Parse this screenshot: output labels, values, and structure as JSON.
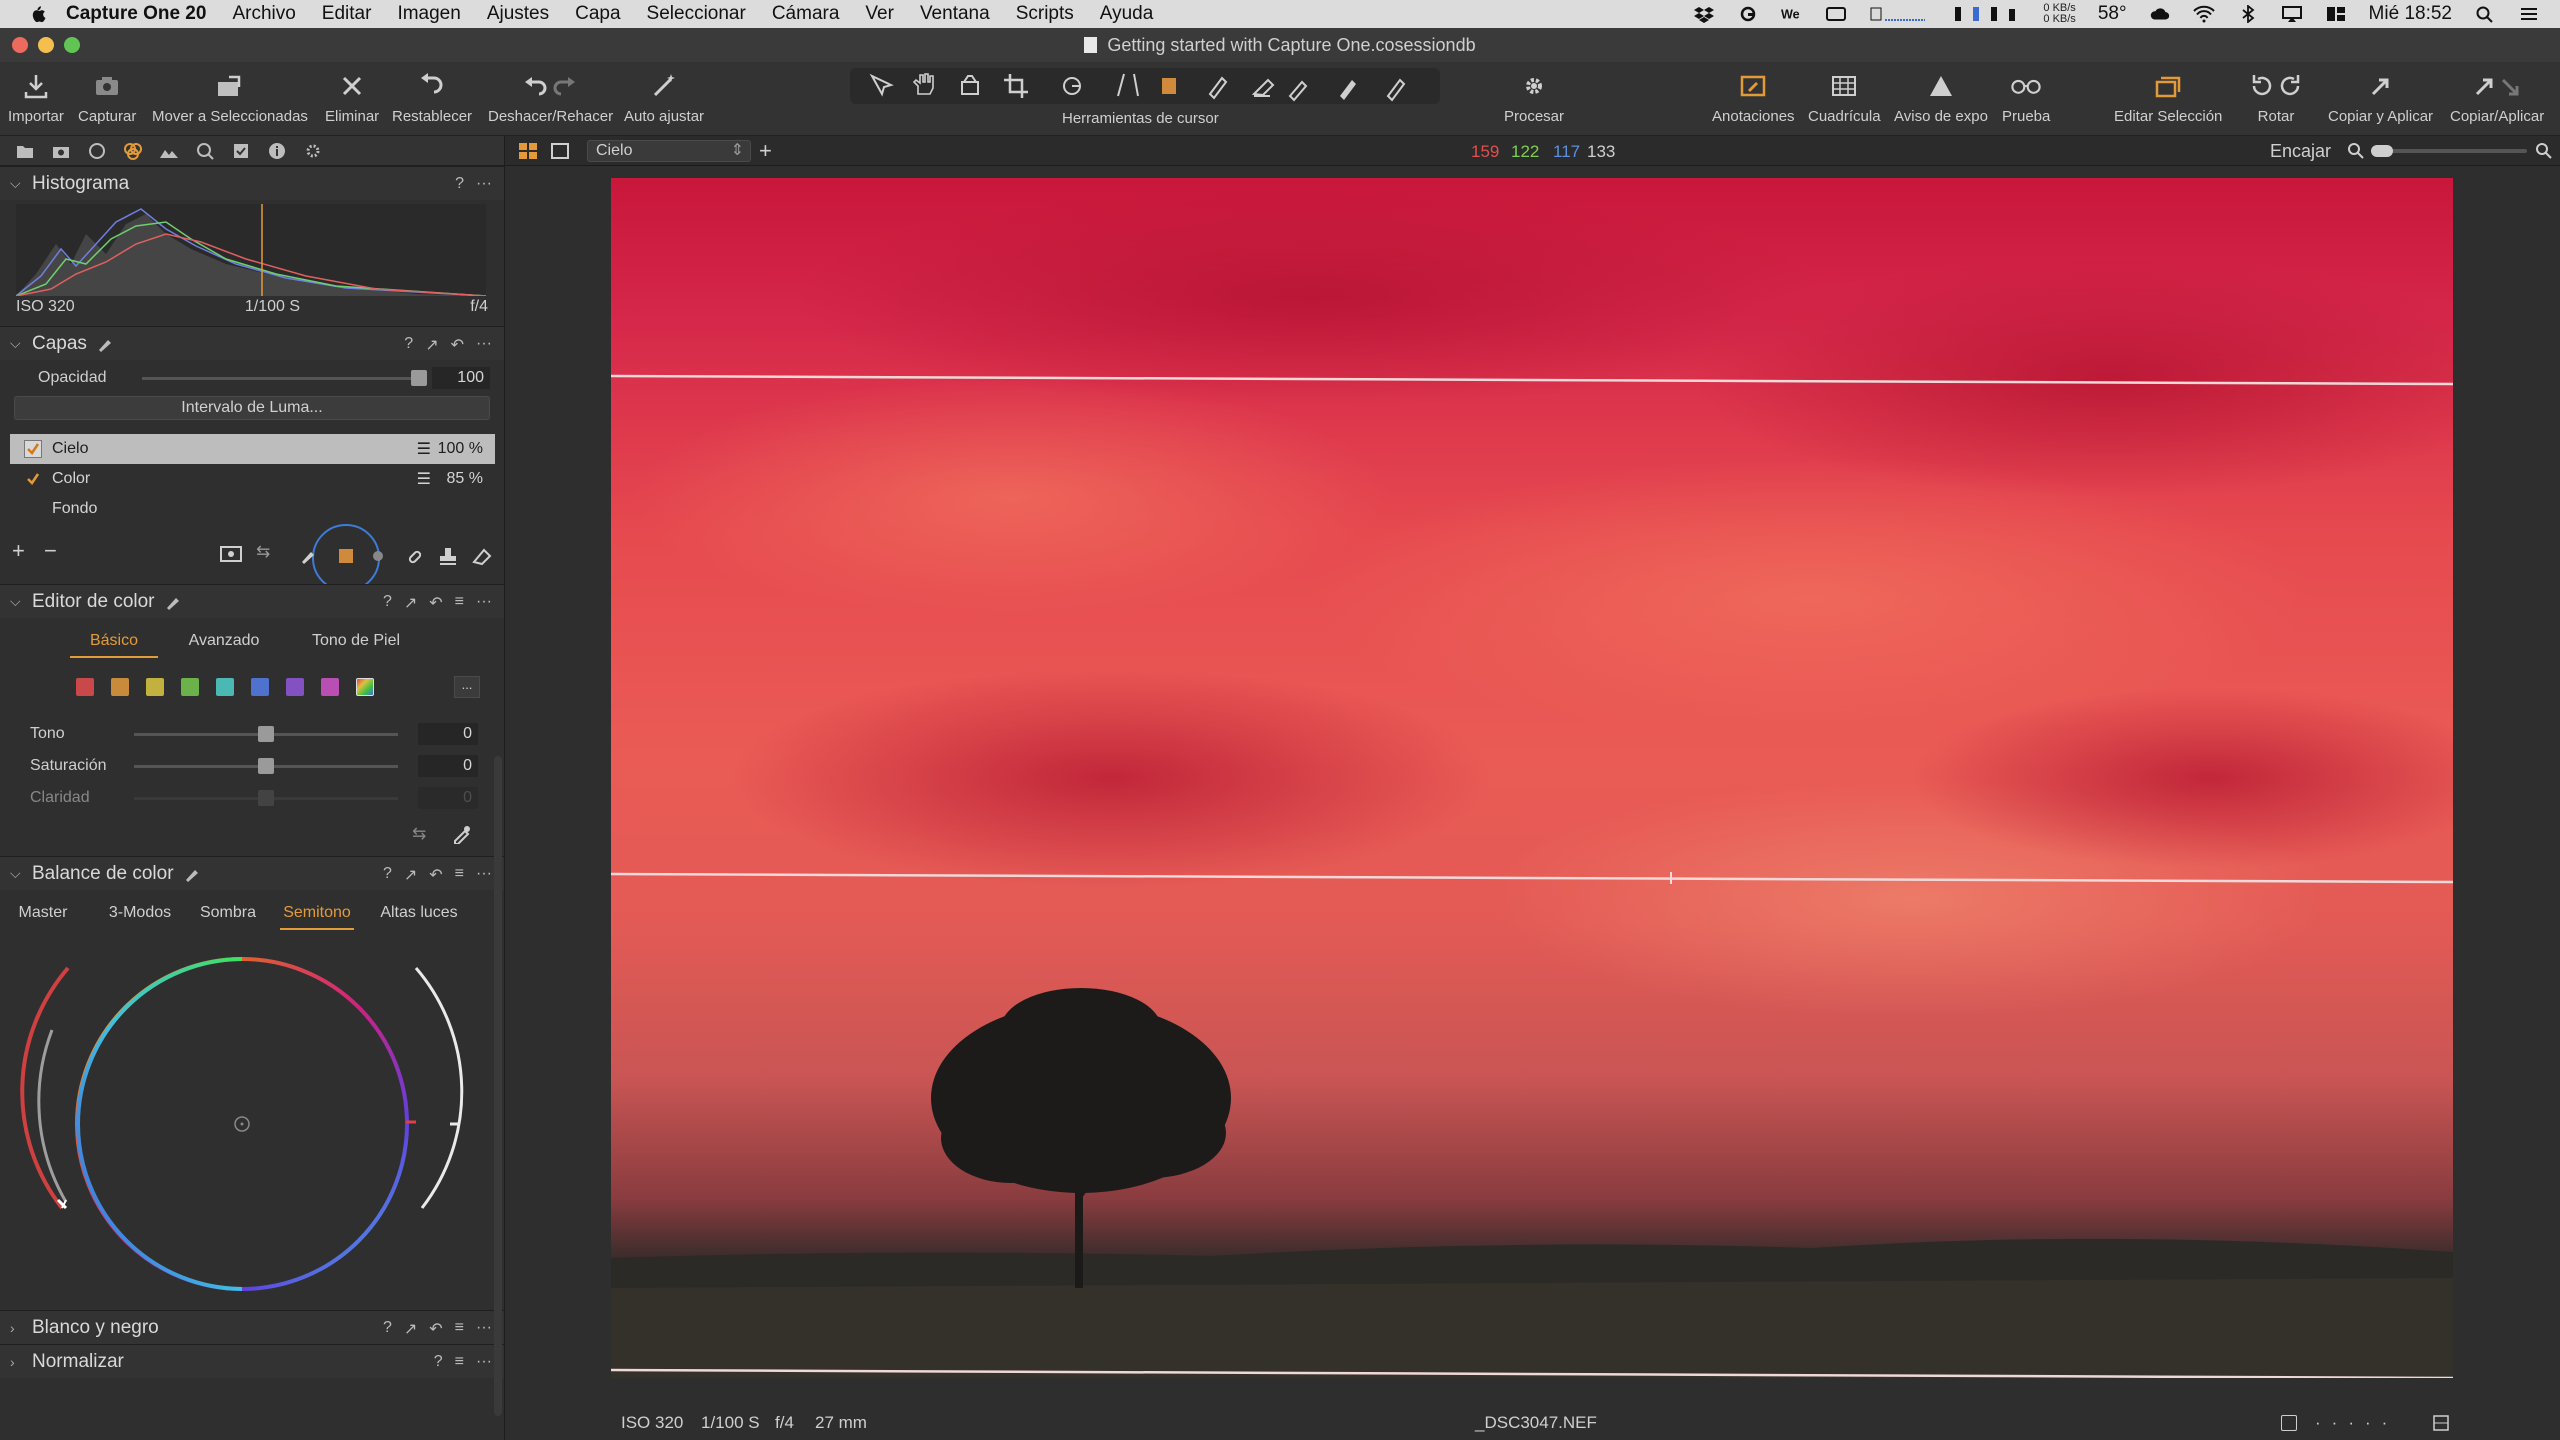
{
  "menubar": {
    "app_name": "Capture One 20",
    "items": [
      "Archivo",
      "Editar",
      "Imagen",
      "Ajustes",
      "Capa",
      "Seleccionar",
      "Cámara",
      "Ver",
      "Ventana",
      "Scripts",
      "Ayuda"
    ],
    "net_up": "0 KB/s",
    "net_down": "0 KB/s",
    "temperature": "58°",
    "clock": "Mié 18:52"
  },
  "window": {
    "title": "Getting started with Capture One.cosessiondb"
  },
  "toolbar": {
    "tools": [
      {
        "label": "Importar",
        "icon": "import-icon"
      },
      {
        "label": "Capturar",
        "icon": "camera-icon"
      },
      {
        "label": "Mover a Seleccionadas",
        "icon": "move-icon"
      },
      {
        "label": "Eliminar",
        "icon": "delete-icon"
      },
      {
        "label": "Restablecer",
        "icon": "reset-icon"
      },
      {
        "label": "Deshacer/Rehacer",
        "icon": "undo-icon"
      },
      {
        "label": "Auto ajustar",
        "icon": "wand-icon"
      }
    ],
    "cursor_tools_label": "Herramientas de cursor",
    "right_tools": [
      {
        "label": "Procesar",
        "icon": "gear-icon"
      },
      {
        "label": "Anotaciones",
        "icon": "annotation-icon"
      },
      {
        "label": "Cuadrícula",
        "icon": "grid-icon"
      },
      {
        "label": "Aviso de expo",
        "icon": "warning-icon"
      },
      {
        "label": "Prueba",
        "icon": "glasses-icon"
      },
      {
        "label": "Editar Selección",
        "icon": "stack-icon"
      },
      {
        "label": "Rotar",
        "icon": "rotate-icon"
      },
      {
        "label": "Copiar y Aplicar",
        "icon": "copy-apply-icon"
      },
      {
        "label": "Copiar/Aplicar",
        "icon": "copy-icon"
      }
    ]
  },
  "histogram": {
    "title": "Histograma",
    "iso": "ISO 320",
    "shutter": "1/100 S",
    "aperture": "f/4"
  },
  "layers": {
    "title": "Capas",
    "opacity_label": "Opacidad",
    "opacity_value": "100",
    "opacity_fraction": 1.0,
    "luma_button": "Intervalo de Luma...",
    "items": [
      {
        "name": "Cielo",
        "pct": "100 %",
        "checked": true,
        "selected": true
      },
      {
        "name": "Color",
        "pct": "85 %",
        "checked": true,
        "selected": false
      },
      {
        "name": "Fondo",
        "pct": "",
        "checked": false,
        "selected": false
      }
    ]
  },
  "color_editor": {
    "title": "Editor de color",
    "tabs": [
      "Básico",
      "Avanzado",
      "Tono de Piel"
    ],
    "active_tab": "Básico",
    "swatches": [
      "#c9484a",
      "#c88a3b",
      "#c2b13f",
      "#6bb24b",
      "#4bb8b3",
      "#4f72cf",
      "#8451c2",
      "#b94fb3"
    ],
    "more_label": "...",
    "sliders": [
      {
        "label": "Tono",
        "value": "0",
        "fraction": 0.5
      },
      {
        "label": "Saturación",
        "value": "0",
        "fraction": 0.5
      },
      {
        "label": "Claridad",
        "value": "0",
        "fraction": 0.5
      }
    ]
  },
  "color_balance": {
    "title": "Balance de color",
    "tabs": [
      "Master",
      "3-Modos",
      "Sombra",
      "Semitono",
      "Altas luces"
    ],
    "active_tab": "Semitono"
  },
  "bw": {
    "title": "Blanco y negro"
  },
  "normalize": {
    "title": "Normalizar"
  },
  "viewer": {
    "layer_select": "Cielo",
    "rgb_r": "159",
    "rgb_g": "122",
    "rgb_b": "117",
    "rgb_l": "133",
    "fit_label": "Encajar",
    "footer": {
      "iso": "ISO 320",
      "shutter": "1/100 S",
      "aperture": "f/4",
      "focal": "27 mm",
      "filename": "_DSC3047.NEF"
    }
  },
  "colors": {
    "accent": "#e39b3a",
    "rgb_red": "#e0504f",
    "rgb_green": "#7fcf4f",
    "rgb_blue": "#5d8fe0"
  }
}
